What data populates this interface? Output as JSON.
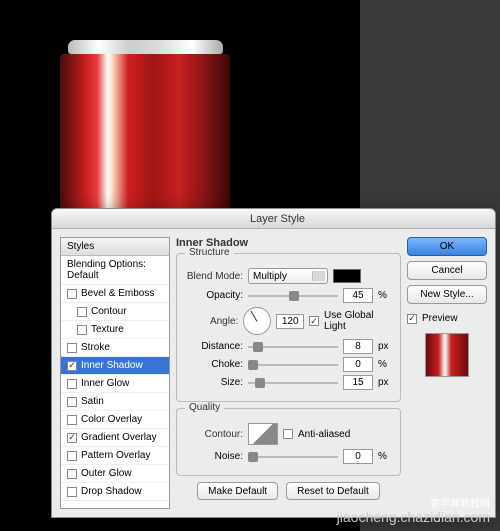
{
  "dialog": {
    "title": "Layer Style"
  },
  "styles": {
    "header": "Styles",
    "blending": "Blending Options: Default",
    "items": [
      "Bevel & Emboss",
      "Contour",
      "Texture",
      "Stroke",
      "Inner Shadow",
      "Inner Glow",
      "Satin",
      "Color Overlay",
      "Gradient Overlay",
      "Pattern Overlay",
      "Outer Glow",
      "Drop Shadow"
    ]
  },
  "panel": {
    "title": "Inner Shadow",
    "structure": {
      "label": "Structure",
      "blend_mode_label": "Blend Mode:",
      "blend_mode": "Multiply",
      "opacity_label": "Opacity:",
      "opacity": "45",
      "angle_label": "Angle:",
      "angle": "120",
      "global_light": "Use Global Light",
      "distance_label": "Distance:",
      "distance": "8",
      "choke_label": "Choke:",
      "choke": "0",
      "size_label": "Size:",
      "size": "15"
    },
    "quality": {
      "label": "Quality",
      "contour_label": "Contour:",
      "anti_aliased": "Anti-aliased",
      "noise_label": "Noise:",
      "noise": "0"
    },
    "make_default": "Make Default",
    "reset_default": "Reset to Default"
  },
  "buttons": {
    "ok": "OK",
    "cancel": "Cancel",
    "new_style": "New Style...",
    "preview": "Preview"
  },
  "units": {
    "pct": "%",
    "px": "px"
  },
  "watermark": {
    "main": "查字典教程网",
    "sub": "jiaocheng.chazidian.com"
  }
}
